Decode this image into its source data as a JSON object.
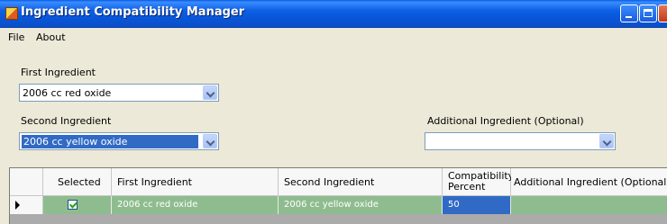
{
  "window": {
    "title": "Ingredient Compatibility Manager"
  },
  "menu": {
    "file": "File",
    "about": "About"
  },
  "form": {
    "first_label": "First Ingredient",
    "first_value": "2006 cc red oxide",
    "second_label": "Second Ingredient",
    "second_value": "2006 cc yellow oxide",
    "additional_label": "Additional Ingredient (Optional)",
    "additional_value": ""
  },
  "grid": {
    "headers": {
      "selected": "Selected",
      "first": "First Ingredient",
      "second": "Second Ingredient",
      "percent_line1": "Compatibility",
      "percent_line2": "Percent",
      "additional": "Additional Ingredient (Optional)"
    },
    "rows": [
      {
        "selected": true,
        "first": "2006 cc red oxide",
        "second": "2006 cc yellow oxide",
        "percent": "50",
        "additional": ""
      }
    ]
  },
  "colors": {
    "selected_row": "#8fbc8f",
    "focus_cell": "#316ac5",
    "titlebar": "#0955d6"
  },
  "icons": [
    "app-icon",
    "minimize-icon",
    "maximize-icon",
    "close-icon",
    "chevron-down-icon",
    "checkbox-checked-icon",
    "row-pointer-icon"
  ]
}
